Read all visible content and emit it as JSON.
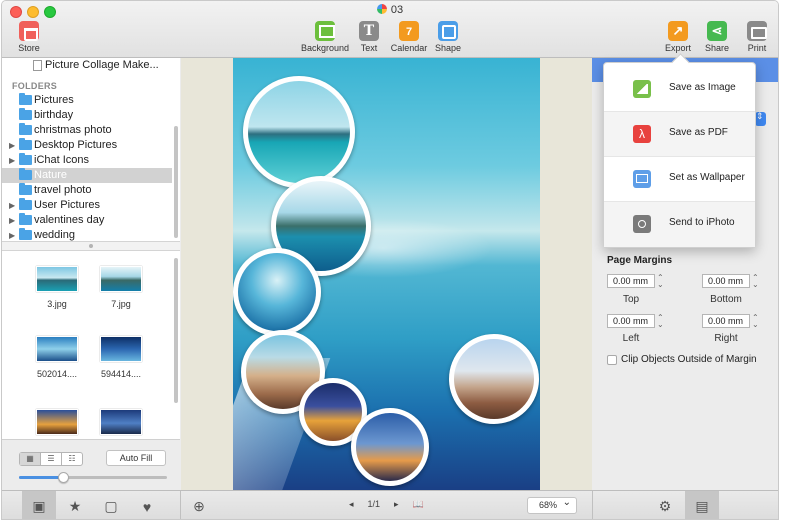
{
  "window": {
    "title": "03"
  },
  "toolbar": {
    "store": "Store",
    "background": "Background",
    "text": "Text",
    "text_glyph": "T",
    "calendar": "Calendar",
    "calendar_glyph": "7",
    "shape": "Shape",
    "export": "Export",
    "share": "Share",
    "print": "Print"
  },
  "sidebar": {
    "top_item": "Picture Collage Make...",
    "folders_heading": "FOLDERS",
    "folders": [
      {
        "label": "Pictures",
        "expandable": false
      },
      {
        "label": "birthday",
        "expandable": false
      },
      {
        "label": "christmas photo",
        "expandable": false
      },
      {
        "label": "Desktop Pictures",
        "expandable": true
      },
      {
        "label": "iChat Icons",
        "expandable": true
      },
      {
        "label": "Nature",
        "expandable": false,
        "selected": true
      },
      {
        "label": "travel photo",
        "expandable": false
      },
      {
        "label": "User Pictures",
        "expandable": true
      },
      {
        "label": "valentines day",
        "expandable": true
      },
      {
        "label": "wedding",
        "expandable": true
      }
    ],
    "thumbnails": [
      {
        "caption": "3.jpg"
      },
      {
        "caption": "7.jpg"
      },
      {
        "caption": "502014...."
      },
      {
        "caption": "594414...."
      },
      {
        "caption": ""
      },
      {
        "caption": ""
      }
    ],
    "view_modes": [
      "▦",
      "☰",
      "☷"
    ],
    "auto_fill": "Auto Fill",
    "thumb_size": 0.3
  },
  "bottombar": {
    "page_indicator": "1/1",
    "prev": "◂",
    "next": "▸",
    "zoom": "68%",
    "zoom_in_glyph": "⊕",
    "book_glyph": "📖",
    "tab_glyphs": [
      "▣",
      "★",
      "▢",
      "♥"
    ],
    "right_tab_glyphs": [
      "⚙",
      "▤"
    ]
  },
  "inspector": {
    "page_margins_title": "Page Margins",
    "top": {
      "label": "Top",
      "value": "0.00 mm"
    },
    "bottom": {
      "label": "Bottom",
      "value": "0.00 mm"
    },
    "left": {
      "label": "Left",
      "value": "0.00 mm"
    },
    "right": {
      "label": "Right",
      "value": "0.00 mm"
    },
    "clip_label": "Clip Objects Outside of Margin",
    "clip_checked": false
  },
  "export_menu": [
    {
      "label": "Save as Image",
      "icon": "image-icon"
    },
    {
      "label": "Save as PDF",
      "icon": "pdf-icon"
    },
    {
      "label": "Set as Wallpaper",
      "icon": "monitor-icon"
    },
    {
      "label": "Send to iPhoto",
      "icon": "camera-icon"
    }
  ],
  "colors": {
    "accent": "#4a90e2",
    "selection": "#d2d2d2",
    "folder": "#4aa3e6"
  }
}
